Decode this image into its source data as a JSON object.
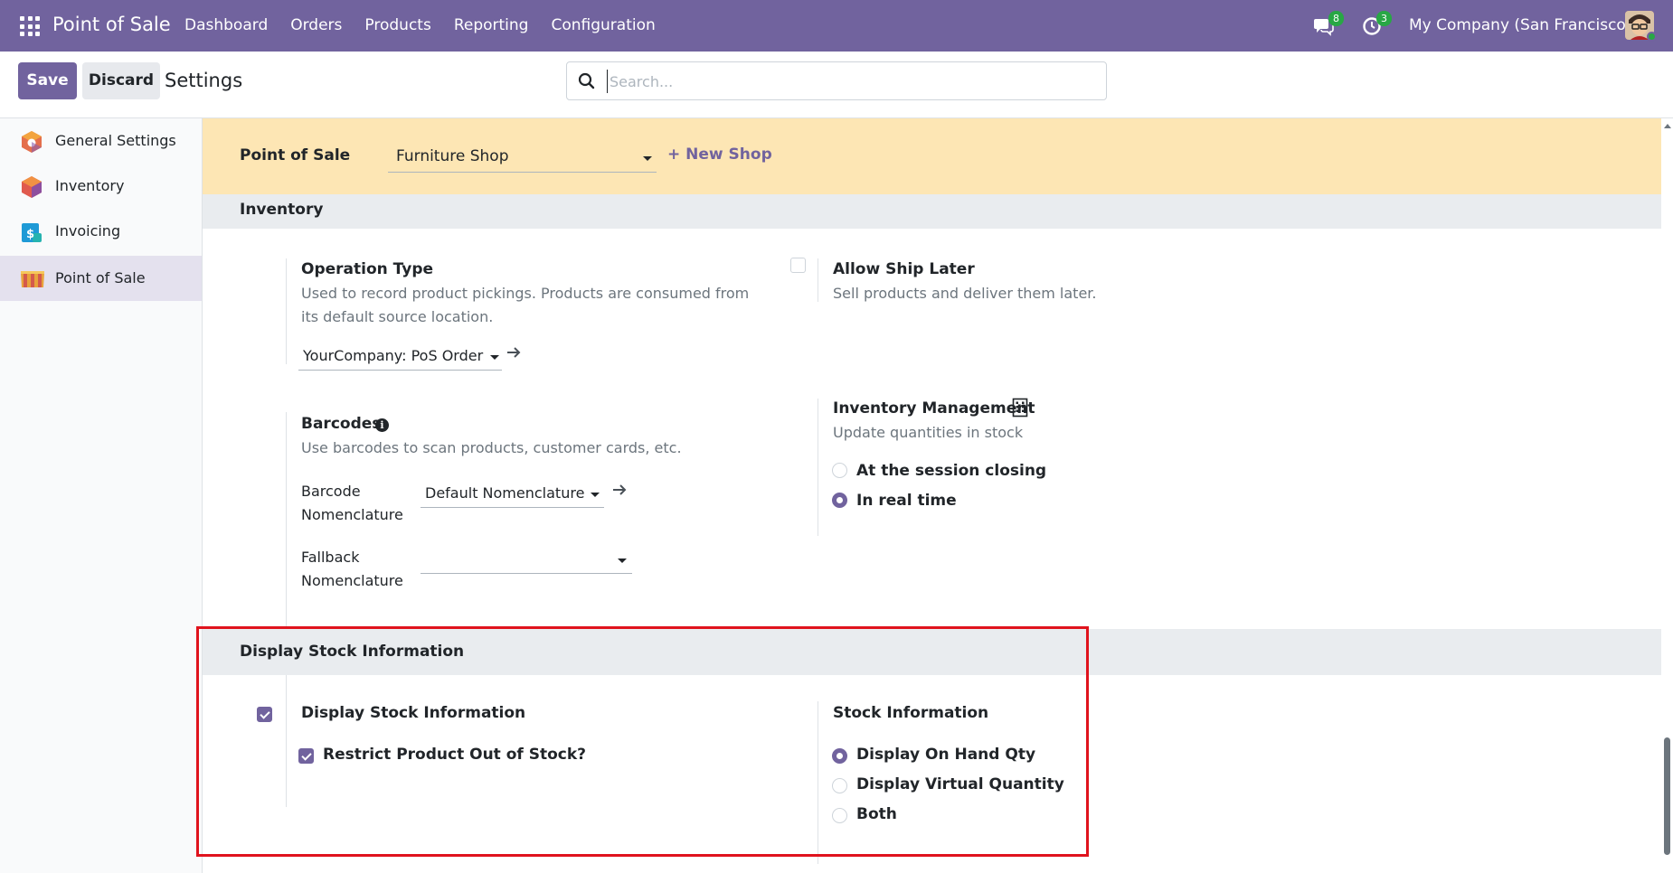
{
  "navbar": {
    "brand": "Point of Sale",
    "menu": [
      "Dashboard",
      "Orders",
      "Products",
      "Reporting",
      "Configuration"
    ],
    "messages_count": "8",
    "activities_count": "3",
    "company": "My Company (San Francisco)"
  },
  "control": {
    "save_label": "Save",
    "discard_label": "Discard",
    "title": "Settings",
    "search_placeholder": "Search..."
  },
  "sidebar": {
    "items": [
      {
        "label": "General Settings",
        "icon": "general-settings-icon"
      },
      {
        "label": "Inventory",
        "icon": "inventory-icon"
      },
      {
        "label": "Invoicing",
        "icon": "invoicing-icon"
      },
      {
        "label": "Point of Sale",
        "icon": "point-of-sale-icon"
      }
    ],
    "active": "Point of Sale"
  },
  "pos_band": {
    "label": "Point of Sale",
    "shop_value": "Furniture Shop",
    "new_shop": "+ New Shop"
  },
  "inventory": {
    "title": "Inventory",
    "operation_type": {
      "title": "Operation Type",
      "desc_line1": "Used to record product pickings. Products are consumed from",
      "desc_line2": "its default source location.",
      "value": "YourCompany: PoS Orders"
    },
    "allow_ship_later": {
      "title": "Allow Ship Later",
      "desc": "Sell products and deliver them later.",
      "checked": false
    },
    "barcodes": {
      "title": "Barcodes",
      "desc": "Use barcodes to scan products, customer cards, etc.",
      "barcode_label_1": "Barcode",
      "barcode_label_2": "Nomenclature",
      "barcode_value": "Default Nomenclature",
      "fallback_label_1": "Fallback",
      "fallback_label_2": "Nomenclature",
      "fallback_value": ""
    },
    "inventory_management": {
      "title": "Inventory Management",
      "desc": "Update quantities in stock",
      "options": [
        "At the session closing",
        "In real time"
      ],
      "selected": "In real time"
    }
  },
  "stock_info": {
    "section_title": "Display Stock Information",
    "display_stock": {
      "label": "Display Stock Information",
      "checked": true
    },
    "restrict": {
      "label": "Restrict Product Out of Stock?",
      "checked": true
    },
    "stock_information": {
      "title": "Stock Information",
      "options": [
        "Display On Hand Qty",
        "Display Virtual Quantity",
        "Both"
      ],
      "selected": "Display On Hand Qty"
    }
  },
  "colors": {
    "navbar": "#71639e",
    "accent": "#71639e",
    "highlight": "#e0131d",
    "band": "#fde6b4"
  }
}
